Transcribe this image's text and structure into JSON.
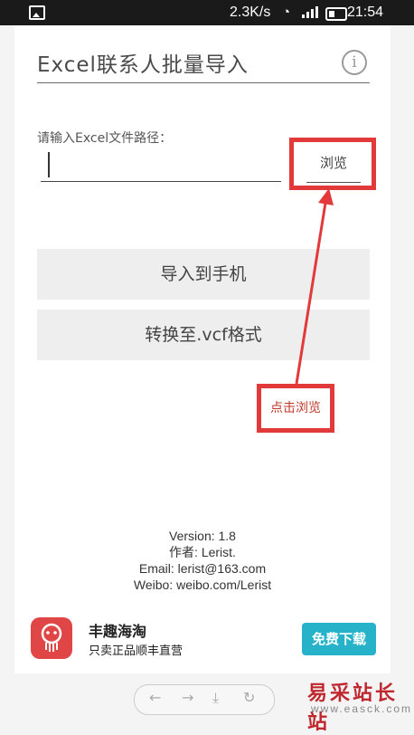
{
  "statusbar": {
    "speed": "2.3K/s",
    "time": "21:54"
  },
  "header": {
    "title": "Excel联系人批量导入",
    "info_icon": "info-icon"
  },
  "form": {
    "path_label": "请输入Excel文件路径：",
    "path_value": "",
    "browse_label": "浏览"
  },
  "actions": {
    "import_label": "导入到手机",
    "convert_label": "转换至.vcf格式"
  },
  "annotation": {
    "text": "点击浏览",
    "color": "#e2393b"
  },
  "about": {
    "version": "Version: 1.8",
    "author": "作者: Lerist.",
    "email": "Email: lerist@163.com",
    "weibo": "Weibo: weibo.com/Lerist"
  },
  "ad": {
    "title": "丰趣海淘",
    "subtitle": "只卖正品顺丰直营",
    "button": "免费下载",
    "button_color": "#26b3c9"
  },
  "watermark": {
    "text": "易采站长站",
    "url": "www.easck.com"
  }
}
